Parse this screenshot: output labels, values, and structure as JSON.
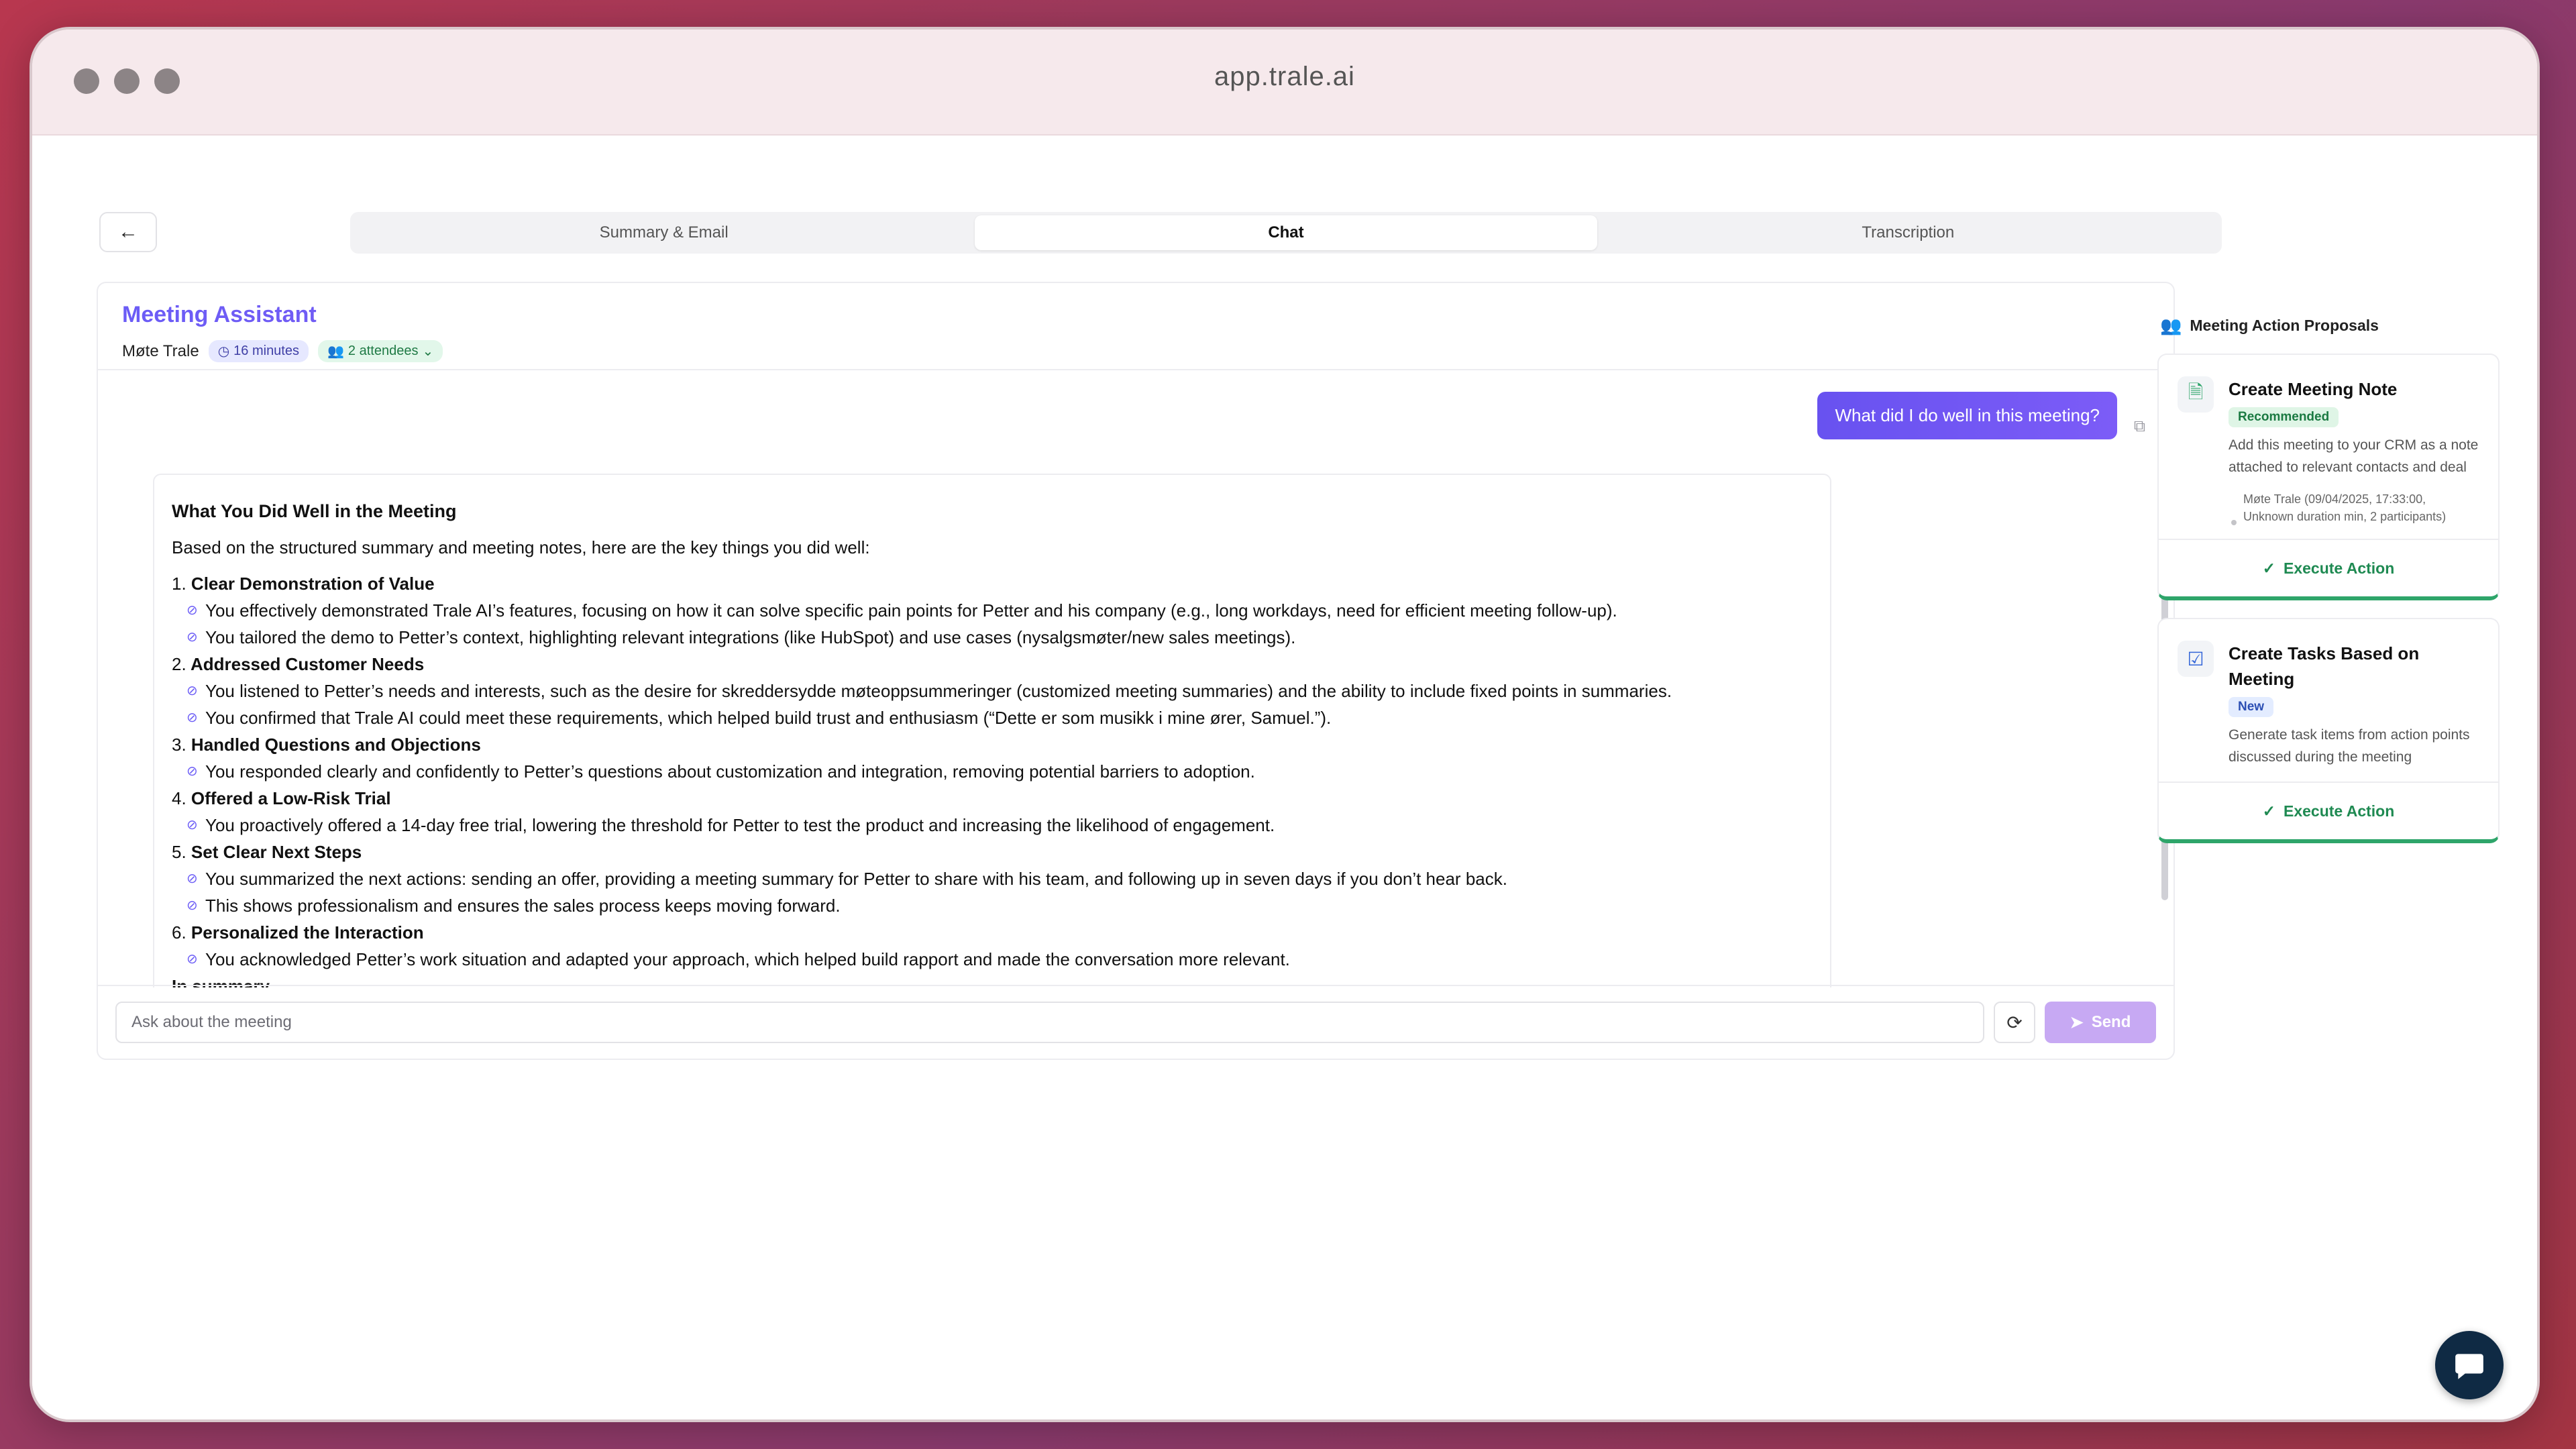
{
  "browser": {
    "url": "app.trale.ai"
  },
  "nav": {
    "back_icon": "arrow-left-icon",
    "tabs": [
      {
        "label": "Summary & Email",
        "active": false
      },
      {
        "label": "Chat",
        "active": true
      },
      {
        "label": "Transcription",
        "active": false
      }
    ]
  },
  "chat": {
    "title": "Meeting Assistant",
    "meeting_name": "Møte Trale",
    "duration": "16 minutes",
    "attendees": "2 attendees",
    "user_message": "What did I do well in this meeting?",
    "response": {
      "title": "What You Did Well in the Meeting",
      "intro": "Based on the structured summary and meeting notes, here are the key things you did well:",
      "items": [
        {
          "num": "1.",
          "title": "Clear Demonstration of Value",
          "bullets": [
            "You effectively demonstrated Trale AI’s features, focusing on how it can solve specific pain points for Petter and his company (e.g., long workdays, need for efficient meeting follow-up).",
            "You tailored the demo to Petter’s context, highlighting relevant integrations (like HubSpot) and use cases (nysalgsmøter/new sales meetings)."
          ]
        },
        {
          "num": "2.",
          "title": "Addressed Customer Needs",
          "bullets": [
            "You listened to Petter’s needs and interests, such as the desire for skreddersydde møteoppsummeringer (customized meeting summaries) and the ability to include fixed points in summaries.",
            "You confirmed that Trale AI could meet these requirements, which helped build trust and enthusiasm (“Dette er som musikk i mine ører, Samuel.”)."
          ]
        },
        {
          "num": "3.",
          "title": "Handled Questions and Objections",
          "bullets": [
            "You responded clearly and confidently to Petter’s questions about customization and integration, removing potential barriers to adoption."
          ]
        },
        {
          "num": "4.",
          "title": "Offered a Low-Risk Trial",
          "bullets": [
            "You proactively offered a 14-day free trial, lowering the threshold for Petter to test the product and increasing the likelihood of engagement."
          ]
        },
        {
          "num": "5.",
          "title": "Set Clear Next Steps",
          "bullets": [
            "You summarized the next actions: sending an offer, providing a meeting summary for Petter to share with his team, and following up in seven days if you don’t hear back.",
            "This shows professionalism and ensures the sales process keeps moving forward."
          ]
        },
        {
          "num": "6.",
          "title": "Personalized the Interaction",
          "bullets": [
            "You acknowledged Petter’s work situation and adapted your approach, which helped build rapport and made the conversation more relevant."
          ]
        }
      ],
      "trailing": "In summary"
    },
    "input_placeholder": "Ask about the meeting",
    "send_label": "Send"
  },
  "actions": {
    "header": "Meeting Action Proposals",
    "cards": [
      {
        "title": "Create Meeting Note",
        "badge": "Recommended",
        "description": "Add this meeting to your CRM as a note attached to relevant contacts and deal",
        "meta": "Møte Trale (09/04/2025, 17:33:00, Unknown duration min, 2 participants)",
        "button": "Execute Action"
      },
      {
        "title": "Create Tasks Based on Meeting",
        "badge": "New",
        "description": "Generate task items from action points discussed during the meeting",
        "button": "Execute Action"
      }
    ]
  },
  "colors": {
    "accent": "#6b5cf6",
    "success": "#2ea56a",
    "send_disabled": "#c7a9f3",
    "widget": "#0f2a44"
  }
}
